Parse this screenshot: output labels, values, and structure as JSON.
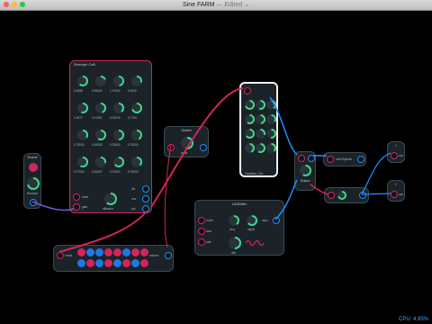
{
  "window": {
    "title": "Sine FARM",
    "subtitle": "— Edited ⌄"
  },
  "status": {
    "cpu": "CPU: 4.95%"
  },
  "modules": {
    "env": {
      "title": "Envelope: Cut0",
      "values": [
        "0.0088",
        "0.00425",
        "1.70000",
        "0.0000",
        "1.0077",
        "0.11003",
        "0.00015",
        "0.7753",
        "0.75000",
        "0.00083",
        "0.76600",
        "0.70000",
        "0.77000",
        "0.00407",
        "0.70000",
        "0.70000"
      ],
      "labels": [
        "cut1",
        "cut2",
        "cut3",
        "cut4"
      ],
      "port_labels": [
        "reset",
        "gate",
        "vca"
      ],
      "ports_right": [
        "clk",
        "out"
      ],
      "knob_label": "diffusion"
    },
    "source": {
      "title": "Source",
      "knob_label": "Random"
    },
    "mid": {
      "title": "Screen",
      "knob_label": "scale"
    },
    "white": {
      "title": "",
      "footer": "Oscillator_Out",
      "knobs": [
        "F1",
        "F2",
        "F3",
        "F4",
        "F5",
        "F6",
        "F7",
        "F8",
        "F9",
        "F10",
        "F11",
        "F12"
      ]
    },
    "bottom": {
      "label_left": "in:dat",
      "label_right": "mIndex"
    },
    "lfo": {
      "title": "Lfo/Shifter",
      "labels": [
        "in-fire",
        "tune",
        "rate",
        "freq",
        "depth",
        "dist",
        "cut"
      ],
      "port_labels": [
        "sync"
      ]
    },
    "mix": {
      "title": "Output"
    },
    "chain": {
      "label": "Limit:Splines"
    },
    "small1": {
      "label": "out"
    },
    "small2": {
      "label": "osc"
    }
  },
  "colors": {
    "red": "#d4245a",
    "blue": "#1e90ff",
    "green": "#3fd98a",
    "panel": "#1b2329"
  }
}
